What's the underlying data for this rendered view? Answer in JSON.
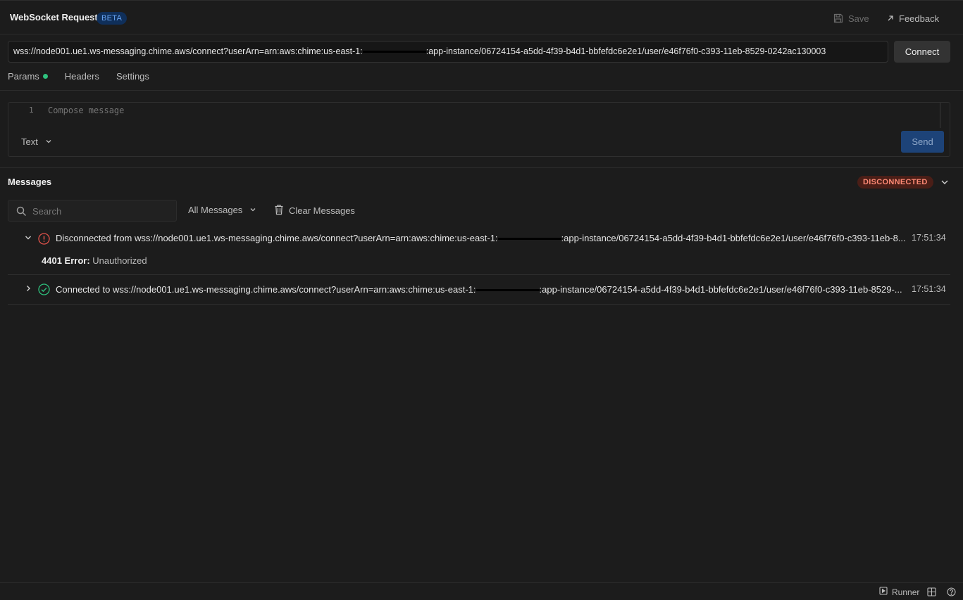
{
  "header": {
    "title": "WebSocket Request",
    "badge": "BETA",
    "save_label": "Save",
    "feedback_label": "Feedback"
  },
  "request": {
    "url_part1": "wss://node001.ue1.ws-messaging.chime.aws/connect?userArn=arn:aws:chime:us-east-1:",
    "url_part2": ":app-instance/06724154-a5dd-4f39-b4d1-bbfefdc6e2e1/user/e46f76f0-c393-11eb-8529-0242ac130003",
    "connect_label": "Connect"
  },
  "tabs": [
    {
      "label": "Params",
      "has_indicator": true
    },
    {
      "label": "Headers"
    },
    {
      "label": "Settings"
    }
  ],
  "composer": {
    "line_number": "1",
    "placeholder": "Compose message",
    "type_value": "Text",
    "send_label": "Send"
  },
  "messages": {
    "title": "Messages",
    "status": "DISCONNECTED",
    "search_placeholder": "Search",
    "filter_value": "All Messages",
    "clear_label": "Clear Messages",
    "items": [
      {
        "text_part1": "Disconnected from wss://node001.ue1.ws-messaging.chime.aws/connect?userArn=arn:aws:chime:us-east-1:",
        "text_part2": ":app-instance/06724154-a5dd-4f39-b4d1-bbfefdc6e2e1/user/e46f76f0-c393-11eb-8...",
        "time": "17:51:34",
        "expanded": true,
        "error_code": "4401 Error:",
        "error_message": "Unauthorized",
        "status_color": "#e5534b"
      },
      {
        "text_part1": "Connected to wss://node001.ue1.ws-messaging.chime.aws/connect?userArn=arn:aws:chime:us-east-1:",
        "text_part2": ":app-instance/06724154-a5dd-4f39-b4d1-bbfefdc6e2e1/user/e46f76f0-c393-11eb-8529-...",
        "time": "17:51:34",
        "expanded": false,
        "status_color": "#2ec27e"
      }
    ]
  },
  "footer": {
    "runner_label": "Runner"
  }
}
